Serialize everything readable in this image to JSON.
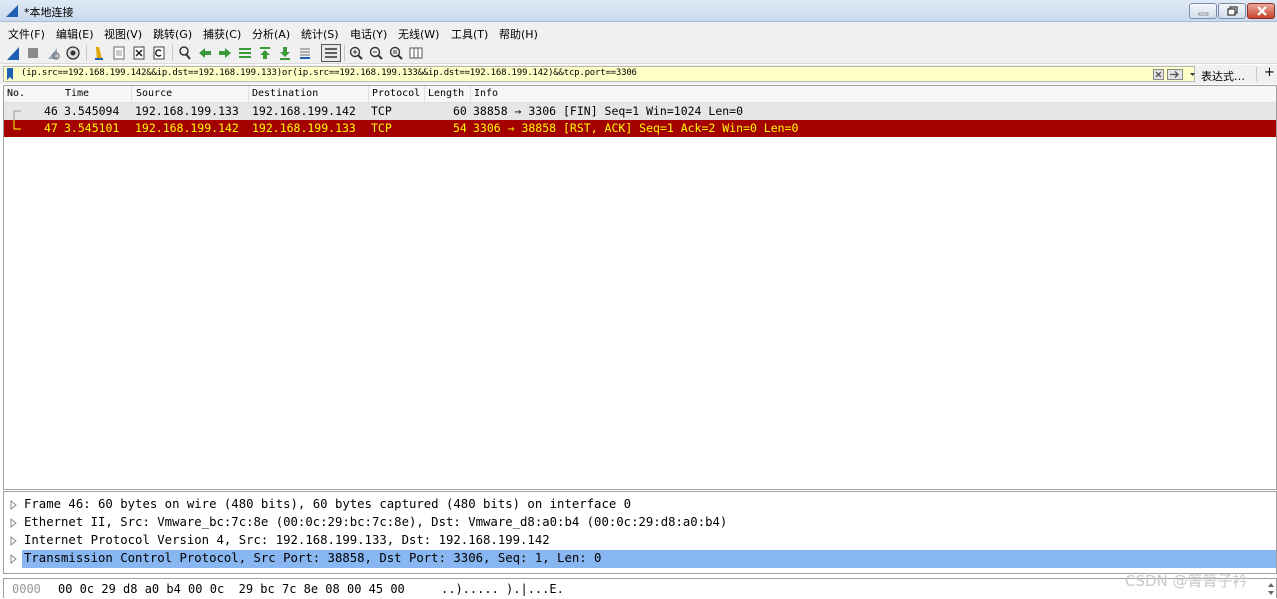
{
  "window": {
    "title": "*本地连接",
    "colors": {
      "selected_row_bg": "#a40000",
      "selected_row_fg": "#ffff00",
      "normal_row_bg": "#e6e6e6",
      "detail_highlight": "#87b6f0",
      "filter_bg": "#ffffc8"
    }
  },
  "menu": [
    "文件(F)",
    "编辑(E)",
    "视图(V)",
    "跳转(G)",
    "捕获(C)",
    "分析(A)",
    "统计(S)",
    "电话(Y)",
    "无线(W)",
    "工具(T)",
    "帮助(H)"
  ],
  "toolbar": {
    "icons": [
      "shark-fin-start-icon",
      "stop-capture-icon",
      "restart-capture-icon",
      "capture-options-icon",
      "open-file-icon",
      "save-file-icon",
      "close-file-icon",
      "reload-icon",
      "find-packet-icon",
      "go-back-icon",
      "go-forward-icon",
      "go-to-packet-icon",
      "go-first-icon",
      "go-last-icon",
      "autoscroll-icon",
      "colorize-icon",
      "zoom-in-icon",
      "zoom-out-icon",
      "zoom-normal-icon",
      "resize-columns-icon"
    ]
  },
  "filter": {
    "value": "(ip.src==192.168.199.142&&ip.dst==192.168.199.133)or(ip.src==192.168.199.133&&ip.dst==192.168.199.142)&&tcp.port==3306",
    "expression_label": "表达式…",
    "add_label": "+"
  },
  "packet_list": {
    "columns": [
      "No.",
      "Time",
      "Source",
      "Destination",
      "Protocol",
      "Length",
      "Info"
    ],
    "rows": [
      {
        "no": "46",
        "time": "3.545094",
        "source": "192.168.199.133",
        "destination": "192.168.199.142",
        "protocol": "TCP",
        "length": "60",
        "info": "38858 → 3306 [FIN] Seq=1 Win=1024 Len=0",
        "selected": false
      },
      {
        "no": "47",
        "time": "3.545101",
        "source": "192.168.199.142",
        "destination": "192.168.199.133",
        "protocol": "TCP",
        "length": "54",
        "info": "3306 → 38858 [RST, ACK] Seq=1 Ack=2 Win=0 Len=0",
        "selected": true
      }
    ]
  },
  "details": [
    {
      "text": "Frame 46: 60 bytes on wire (480 bits), 60 bytes captured (480 bits) on interface 0",
      "highlighted": false
    },
    {
      "text": "Ethernet II, Src: Vmware_bc:7c:8e (00:0c:29:bc:7c:8e), Dst: Vmware_d8:a0:b4 (00:0c:29:d8:a0:b4)",
      "highlighted": false
    },
    {
      "text": "Internet Protocol Version 4, Src: 192.168.199.133, Dst: 192.168.199.142",
      "highlighted": false
    },
    {
      "text": "Transmission Control Protocol, Src Port: 38858, Dst Port: 3306, Seq: 1, Len: 0",
      "highlighted": true
    }
  ],
  "bytes": {
    "offset": "0000",
    "hex": "00 0c 29 d8 a0 b4 00 0c  29 bc 7c 8e 08 00 45 00",
    "ascii": "..)..... ).|...E."
  },
  "watermark": "CSDN @箐箐子衿"
}
